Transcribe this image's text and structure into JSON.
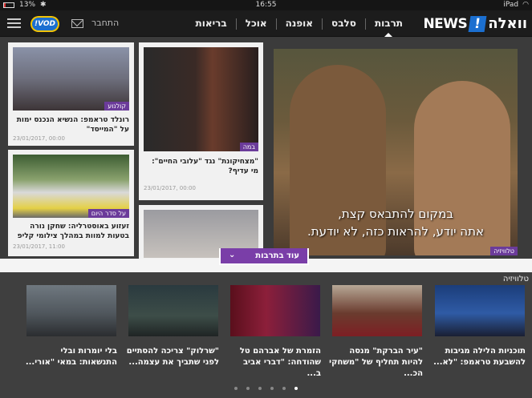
{
  "status_bar": {
    "battery": "13%",
    "time": "16:55",
    "device": "iPad"
  },
  "nav": {
    "logo_text": "וואלה",
    "logo_mark": "!",
    "logo_news": "NEWS",
    "items": [
      {
        "label": "תרבות",
        "active": true
      },
      {
        "label": "סלבס"
      },
      {
        "label": "אופנה"
      },
      {
        "label": "אוכל"
      },
      {
        "label": "בריאות"
      }
    ],
    "connect_label": "התחבר",
    "vod_label": "VOD!"
  },
  "hero": {
    "subtitle_line1": "במקום להתבאס קצת,",
    "subtitle_line2": "אתה יודע, להראות כזה, לא יודעת.",
    "tag": "טלוויזיה"
  },
  "cards": [
    {
      "title": "\"מצחיקונת\" נגד \"עלובי החיים\": מי עדיף?",
      "tag": "במה",
      "date": "23/01/2017, 00:00"
    },
    {
      "title": "רונלד טראמפ: הנשיא הנכנס ימות על \"המייסד\"",
      "tag": "קולנוע",
      "date": "23/01/2017, 00:00"
    },
    {
      "title": "זעזוע באוסטרליה: שחקן נורה בטעות למוות במהלך צילומי קליפ",
      "tag": "על סדר היום",
      "date": "23/01/2017, 11:00"
    }
  ],
  "more_button": {
    "label": "עוד בתרבות"
  },
  "bottom": {
    "section_title": "טלוויזיה",
    "items": [
      {
        "title": "תוכניות הלילה מגיבות להשבעת טראמפ: \"לא..."
      },
      {
        "title": "\"עיר הברקת\" מנסה להיות תחליף של \"משחקי הכ..."
      },
      {
        "title": "הזמרת של אברהם טל שהודחה: \"דברי אביב ב..."
      },
      {
        "title": "\"שרלוק\" צריכה להסתיים לפני שתביך את עצמה..."
      },
      {
        "title": "בלי יומרות ובלי התנשאות: במאי \"אורי..."
      }
    ],
    "pages": 6,
    "active_page": 1
  },
  "colors": {
    "accent": "#7a3ea8",
    "tag": "#6b3b9a",
    "logo_blue": "#1b6fd0",
    "vod_yellow": "#f2c300"
  }
}
